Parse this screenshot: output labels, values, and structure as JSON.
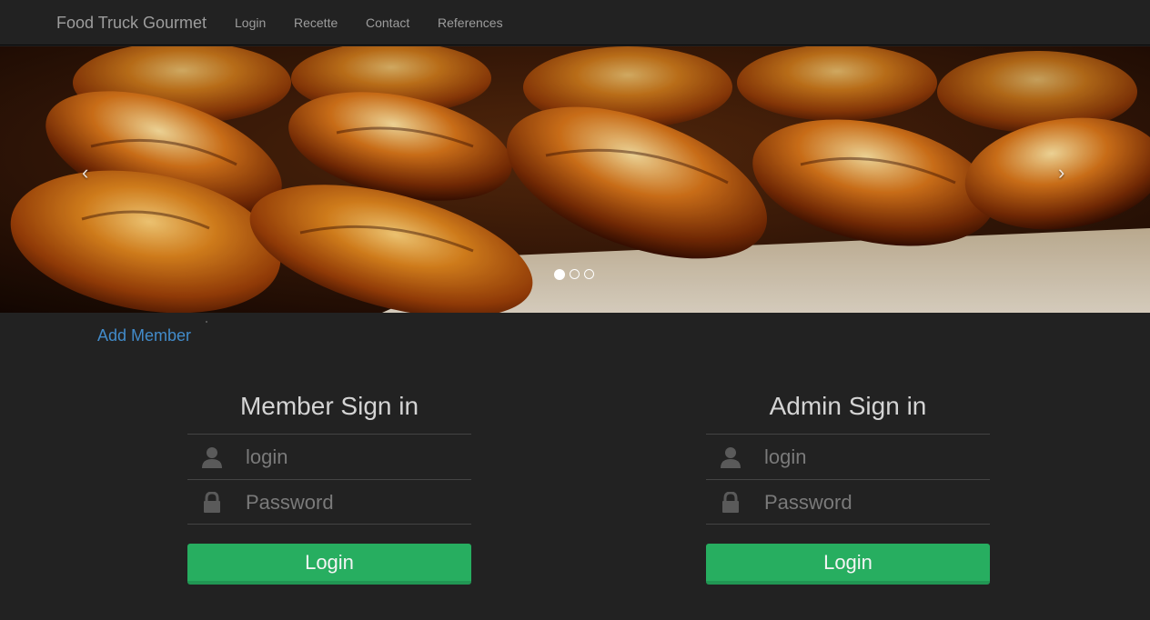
{
  "navbar": {
    "brand": "Food Truck Gourmet",
    "links": [
      "Login",
      "Recette",
      "Contact",
      "References"
    ]
  },
  "carousel": {
    "prev_glyph": "‹",
    "next_glyph": "›",
    "slide_count": 3,
    "active_index": 0,
    "image_subject": "croissants"
  },
  "add_member": "Add Member",
  "member": {
    "title": "Member Sign in",
    "login_placeholder": "login",
    "password_placeholder": "Password",
    "button": "Login"
  },
  "admin": {
    "title": "Admin Sign in",
    "login_placeholder": "login",
    "password_placeholder": "Password",
    "button": "Login"
  },
  "icons": {
    "user": "user-icon",
    "lock": "lock-icon"
  },
  "colors": {
    "background": "#222222",
    "link": "#428bca",
    "button": "#27ae60"
  }
}
